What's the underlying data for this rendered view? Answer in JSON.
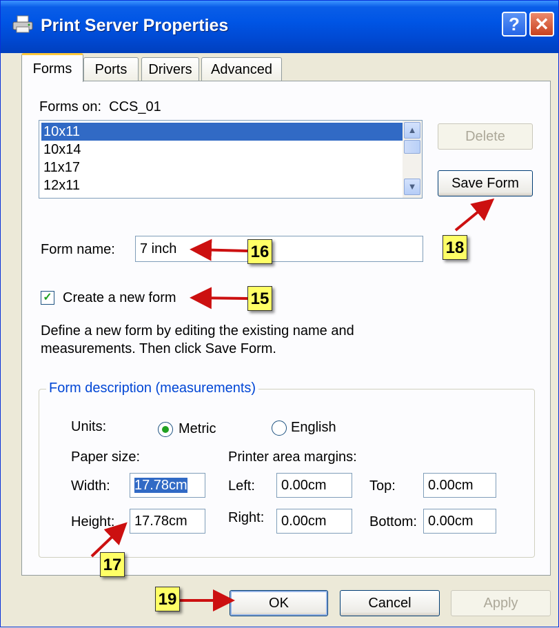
{
  "window": {
    "title": "Print Server Properties"
  },
  "tabs": [
    "Forms",
    "Ports",
    "Drivers",
    "Advanced"
  ],
  "forms": {
    "label": "Forms on:",
    "server": "CCS_01",
    "items": [
      "10x11",
      "10x14",
      "11x17",
      "12x11"
    ],
    "selected_index": 0,
    "delete_label": "Delete",
    "save_label": "Save Form",
    "form_name_label": "Form name:",
    "form_name_value": "7 inch",
    "create_new_label": "Create a new form",
    "create_new_checked": true,
    "help_line1": "Define a new form by editing the existing name and",
    "help_line2": "measurements.  Then click Save Form."
  },
  "description": {
    "title": "Form description (measurements)",
    "units_label": "Units:",
    "metric_label": "Metric",
    "english_label": "English",
    "units_selected": "Metric",
    "paper_size_label": "Paper size:",
    "margins_label": "Printer area margins:",
    "width_label": "Width:",
    "width_value": "17.78cm",
    "height_label": "Height:",
    "height_value": "17.78cm",
    "left_label": "Left:",
    "left_value": "0.00cm",
    "right_label": "Right:",
    "right_value": "0.00cm",
    "top_label": "Top:",
    "top_value": "0.00cm",
    "bottom_label": "Bottom:",
    "bottom_value": "0.00cm"
  },
  "footer": {
    "ok_label": "OK",
    "cancel_label": "Cancel",
    "apply_label": "Apply"
  },
  "annotations": {
    "b15": "15",
    "b16": "16",
    "b17": "17",
    "b18": "18",
    "b19": "19"
  },
  "colors": {
    "titlebar": "#0055e5",
    "selection": "#316ac5",
    "badge": "#ffff66",
    "arrow": "#cc1010"
  },
  "icons": {
    "title": "printer-icon",
    "help": "question-mark-icon",
    "close": "close-x-icon"
  }
}
